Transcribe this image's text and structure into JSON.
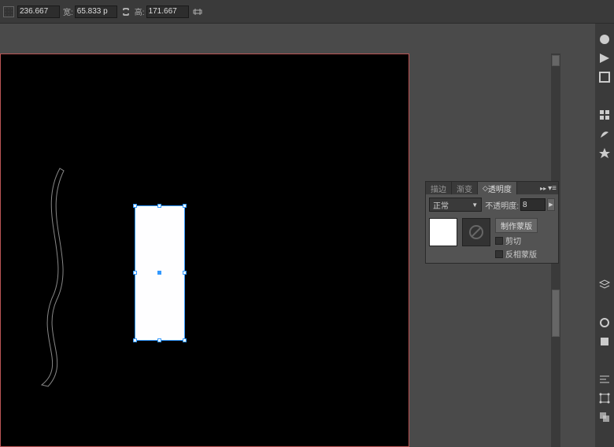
{
  "toolbar": {
    "x_value": "236.667",
    "w_label": "宽:",
    "w_value": "65.833 p",
    "h_label": "高:",
    "h_value": "171.667"
  },
  "panel": {
    "tabs": {
      "stroke": "描边",
      "gradient": "渐变",
      "transparency": "透明度"
    },
    "blend_mode": "正常",
    "opacity_label": "不透明度:",
    "opacity_value": "8",
    "make_mask": "制作蒙版",
    "clip": "剪切",
    "invert": "反相蒙版"
  }
}
